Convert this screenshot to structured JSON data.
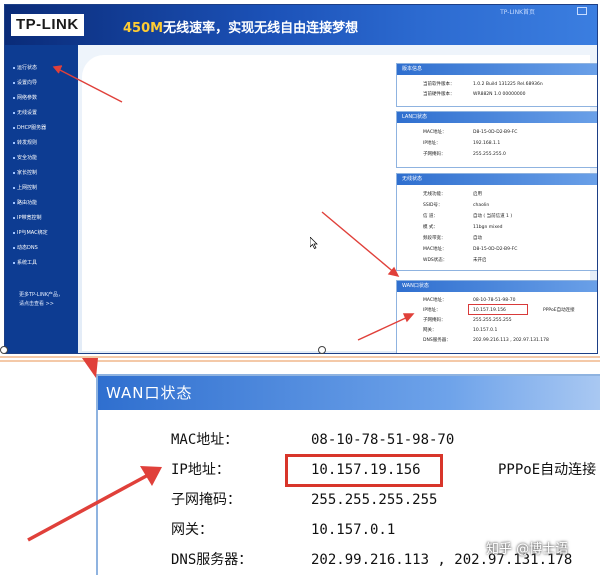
{
  "app": {
    "logo": "TP-LINK",
    "slogan_highlight": "450M",
    "slogan_text": "无线速率，实现无线自由连接梦想",
    "top_link": "TP-LINK首页"
  },
  "sidebar": {
    "items": [
      {
        "label": "运行状态"
      },
      {
        "label": "设置向导"
      },
      {
        "label": "网络参数"
      },
      {
        "label": "无线设置"
      },
      {
        "label": "DHCP服务器"
      },
      {
        "label": "转发规则"
      },
      {
        "label": "安全功能"
      },
      {
        "label": "家长控制"
      },
      {
        "label": "上网控制"
      },
      {
        "label": "路由功能"
      },
      {
        "label": "IP带宽控制"
      },
      {
        "label": "IP与MAC绑定"
      },
      {
        "label": "动态DNS"
      },
      {
        "label": "系统工具"
      }
    ],
    "more_line1": "更多TP-LINK产品，",
    "more_line2": "请点击查看 >>"
  },
  "panels": {
    "version": {
      "title": "版本信息",
      "rows": [
        {
          "label": "当前软件版本：",
          "value": "1.0.2 Build 131225 Rel.68936n"
        },
        {
          "label": "当前硬件版本：",
          "value": "WR882N 1.0 00000000"
        }
      ]
    },
    "lan": {
      "title": "LAN口状态",
      "rows": [
        {
          "label": "MAC地址：",
          "value": "D8-15-0D-D2-B9-FC"
        },
        {
          "label": "IP地址：",
          "value": "192.168.1.1"
        },
        {
          "label": "子网掩码：",
          "value": "255.255.255.0"
        }
      ]
    },
    "wireless": {
      "title": "无线状态",
      "rows": [
        {
          "label": "无线功能：",
          "value": "启用"
        },
        {
          "label": "SSID号：",
          "value": "chaolin"
        },
        {
          "label": "信 道：",
          "value": "自动 ( 当前信道 1 )"
        },
        {
          "label": "模 式：",
          "value": "11bgn mixed"
        },
        {
          "label": "频段带宽：",
          "value": "自动"
        },
        {
          "label": "MAC地址：",
          "value": "D8-15-0D-D2-B9-FC"
        },
        {
          "label": "WDS状态：",
          "value": "未开启"
        }
      ]
    },
    "wan": {
      "title": "WAN口状态",
      "rows": [
        {
          "label": "MAC地址：",
          "value": "08-10-78-51-98-70"
        },
        {
          "label": "IP地址：",
          "value": "10.157.19.156",
          "extra": "PPPoE自动连接"
        },
        {
          "label": "子网掩码：",
          "value": "255.255.255.255"
        },
        {
          "label": "网关：",
          "value": "10.157.0.1"
        },
        {
          "label": "DNS服务器：",
          "value": "202.99.216.113 , 202.97.131.178"
        }
      ]
    }
  },
  "zoom": {
    "title": "WAN口状态",
    "rows": [
      {
        "label": "MAC地址：",
        "value": "08-10-78-51-98-70"
      },
      {
        "label": "IP地址：",
        "value": "10.157.19.156",
        "extra": "PPPoE自动连接"
      },
      {
        "label": "子网掩码：",
        "value": "255.255.255.255"
      },
      {
        "label": "网关：",
        "value": "10.157.0.1"
      },
      {
        "label": "DNS服务器：",
        "value": "202.99.216.113 , 202.97.131.178"
      }
    ]
  },
  "watermark": "知乎 @博士语",
  "colors": {
    "banner": "#1c52b8",
    "sidebar": "#0d3c92",
    "panel_head": "#2f6fcf",
    "highlight_box": "#d8352a",
    "arrow": "#e0403a",
    "separator": "#f4c9a8"
  }
}
